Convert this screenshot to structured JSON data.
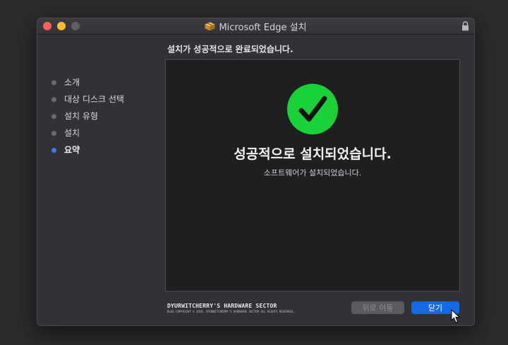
{
  "window": {
    "title": "Microsoft Edge 설치",
    "icons": {
      "app": "package-icon",
      "lock": "lock-icon"
    }
  },
  "header": {
    "text": "설치가 성공적으로 완료되었습니다."
  },
  "sidebar": {
    "steps": [
      {
        "label": "소개",
        "active": false
      },
      {
        "label": "대상 디스크 선택",
        "active": false
      },
      {
        "label": "설치 유형",
        "active": false
      },
      {
        "label": "설치",
        "active": false
      },
      {
        "label": "요약",
        "active": true
      }
    ]
  },
  "main": {
    "status_icon": "checkmark-circle-icon",
    "success_title": "성공적으로 설치되었습니다.",
    "success_subtitle": "소프트웨어가 설치되었습니다."
  },
  "brand": {
    "title": "DYURWITCHERRY'S HARDWARE SECTOR",
    "copyright": "BLOG COPYRIGHT © 2010. DYURWITCHERRY'S HARDWARE SECTOR ALL RIGHTS RESERVED."
  },
  "footer": {
    "back_label": "뒤로 이동",
    "close_label": "닫기"
  },
  "colors": {
    "accent": "#1369e6",
    "success": "#19d238",
    "active_step": "#2f7df6"
  }
}
